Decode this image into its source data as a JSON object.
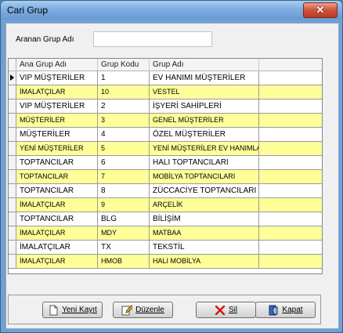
{
  "window": {
    "title": "Cari Grup",
    "close_symbol": "✕"
  },
  "search": {
    "label": "Aranan Grup Adı",
    "value": ""
  },
  "grid": {
    "columns": [
      "Ana Grup Adı",
      "Grup Kodu",
      "Grup Adı"
    ],
    "rows": [
      {
        "ana_grup": "VIP MÜŞTERİLER",
        "kod": "1",
        "ad": "EV HANIMI MÜŞTERİLER"
      },
      {
        "ana_grup": "İMALATÇILAR",
        "kod": "10",
        "ad": "VESTEL"
      },
      {
        "ana_grup": "VIP MÜŞTERİLER",
        "kod": "2",
        "ad": "İŞYERİ SAHİPLERİ"
      },
      {
        "ana_grup": "MÜŞTERİLER",
        "kod": "3",
        "ad": "GENEL MÜŞTERİLER"
      },
      {
        "ana_grup": "MÜŞTERİLER",
        "kod": "4",
        "ad": "ÖZEL MÜŞTERİLER"
      },
      {
        "ana_grup": "YENİ MÜŞTERİLER",
        "kod": "5",
        "ad": "YENİ MÜŞTERİLER EV HANIMLARI"
      },
      {
        "ana_grup": "TOPTANCILAR",
        "kod": "6",
        "ad": "HALI TOPTANCILARI"
      },
      {
        "ana_grup": "TOPTANCILAR",
        "kod": "7",
        "ad": "MOBİLYA TOPTANCILARI"
      },
      {
        "ana_grup": "TOPTANCILAR",
        "kod": "8",
        "ad": "ZÜCCACİYE TOPTANCILARI"
      },
      {
        "ana_grup": "İMALATÇILAR",
        "kod": "9",
        "ad": "ARÇELİK"
      },
      {
        "ana_grup": "TOPTANCILAR",
        "kod": "BLG",
        "ad": "BİLİŞİM"
      },
      {
        "ana_grup": "İMALATÇILAR",
        "kod": "MDY",
        "ad": "MATBAA"
      },
      {
        "ana_grup": "İMALATÇILAR",
        "kod": "TX",
        "ad": "TEKSTİL"
      },
      {
        "ana_grup": "İMALATÇILAR",
        "kod": "HMOB",
        "ad": "HALI MOBİLYA"
      }
    ],
    "selected_row": 0,
    "alt_row_color": "#ffff9a"
  },
  "buttons": {
    "new": {
      "label": "Yeni Kayıt",
      "icon": "new-document-icon"
    },
    "edit": {
      "label": "Düzenle",
      "icon": "edit-icon"
    },
    "delete": {
      "label": "Sil",
      "icon": "delete-icon"
    },
    "close": {
      "label": "Kapat",
      "icon": "exit-door-icon"
    }
  }
}
